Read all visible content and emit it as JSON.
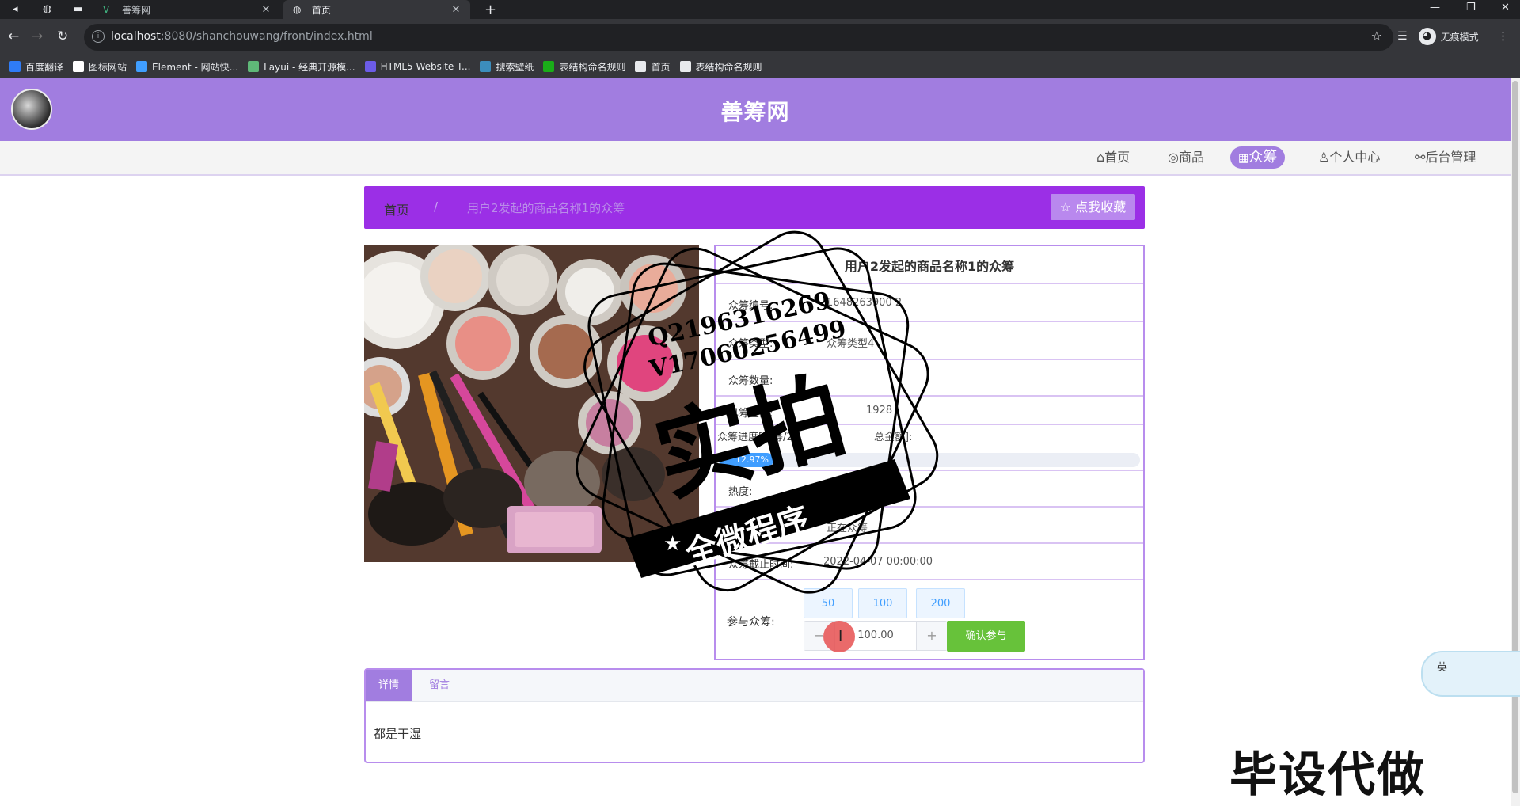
{
  "browser": {
    "tabs": [
      {
        "title": "善筹网",
        "active": false
      },
      {
        "title": "首页",
        "active": true
      }
    ],
    "url_host": "localhost",
    "url_rest": ":8080/shanchouwang/front/index.html",
    "profile_label": "无痕模式",
    "bookmarks": [
      {
        "label": "百度翻译",
        "icon": "translate-icon",
        "color": "#2f7cf6"
      },
      {
        "label": "图标网站",
        "icon": "flag-icon",
        "color": "#ffffff"
      },
      {
        "label": "Element - 网站快...",
        "icon": "element-icon",
        "color": "#409eff"
      },
      {
        "label": "Layui - 经典开源模...",
        "icon": "layui-icon",
        "color": "#5fb878"
      },
      {
        "label": "HTML5 Website T...",
        "icon": "html5-icon",
        "color": "#6c5ce7"
      },
      {
        "label": "搜索壁纸",
        "icon": "wallpaper-icon",
        "color": "#3c8dbc"
      },
      {
        "label": "表结构命名规则",
        "icon": "sheet-icon",
        "color": "#1aad19"
      },
      {
        "label": "首页",
        "icon": "globe-icon",
        "color": "#e8eaed"
      },
      {
        "label": "表结构命名规则",
        "icon": "globe-icon",
        "color": "#e8eaed"
      }
    ]
  },
  "site": {
    "title": "善筹网",
    "nav": [
      {
        "label": "首页",
        "icon": "home-icon"
      },
      {
        "label": "商品",
        "icon": "palette-icon"
      },
      {
        "label": "众筹",
        "icon": "gift-icon",
        "active": true
      },
      {
        "label": "个人中心",
        "icon": "user-icon"
      },
      {
        "label": "后台管理",
        "icon": "link-icon"
      }
    ],
    "breadcrumb": {
      "home": "首页",
      "separator": "/",
      "current": "用户2发起的商品名称1的众筹"
    },
    "favorite_label": "☆ 点我收藏"
  },
  "detail": {
    "title": "用户2发起的商品名称1的众筹",
    "rows": [
      {
        "label": "众筹编号:",
        "value": "1648263900 2"
      },
      {
        "label": "众筹类型:",
        "value": "众筹类型4"
      },
      {
        "label": "众筹数量:",
        "value": ""
      },
      {
        "label": "已筹金额:",
        "value": "1928"
      },
      {
        "label": "众筹进度[已筹/25",
        "value": "总金额]:"
      },
      {
        "label": "热度:",
        "value": ""
      },
      {
        "label": "",
        "value": "正在众筹"
      },
      {
        "label": "众筹截止时间:",
        "value": "2022-04-07 00:00:00"
      }
    ],
    "progress_percent": 12.97,
    "progress_text": "12.97%",
    "participate_label": "参与众筹:",
    "amount_options": [
      "50",
      "100",
      "200"
    ],
    "amount_value": "100.00",
    "minus": "−",
    "plus": "+",
    "confirm_label": "确认参与"
  },
  "tabs": {
    "items": [
      "详情",
      "留言"
    ],
    "content": "都是干湿"
  },
  "watermark": {
    "qq": "Q2196316269",
    "vx": "V17060256499",
    "big": "实拍",
    "ribbon": "全微程序",
    "corner": "毕设代做"
  },
  "translate_widget": "英",
  "colors": {
    "header": "#a17de0",
    "breadcrumb": "#9b2fe6",
    "border": "#b88ded",
    "confirm": "#67c23a",
    "progress": "#409eff"
  }
}
